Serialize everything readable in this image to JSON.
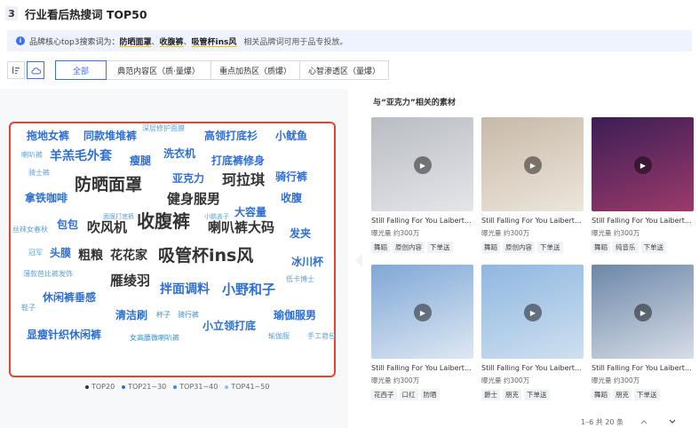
{
  "header": {
    "step": "3",
    "title": "行业看后热搜词 TOP50"
  },
  "notice": {
    "prefix": "品牌核心top3搜索词为：",
    "keywords": [
      "防晒面罩",
      "收腹裤",
      "吸管杯ins风"
    ],
    "sep": "、",
    "tail": "相关品牌词可用于品专投放。"
  },
  "toolbar": {
    "filters": [
      "全部",
      "典范内容区（质·量爆）",
      "重点加热区（质爆）",
      "心智渗透区（量爆）"
    ]
  },
  "cloud": {
    "words": [
      {
        "text": "拖地女裤",
        "tier": 2
      },
      {
        "text": "同款堆堆裤",
        "tier": 2
      },
      {
        "text": "深层修护面膜",
        "tier": 4
      },
      {
        "text": "高领打底衫",
        "tier": 2
      },
      {
        "text": "小鱿鱼",
        "tier": 2
      },
      {
        "text": "洗衣机",
        "tier": 2
      },
      {
        "text": "喇叭裤",
        "tier": 4
      },
      {
        "text": "羊羔毛外套",
        "tier": 2
      },
      {
        "text": "瘦腿",
        "tier": 2
      },
      {
        "text": "打底裤修身",
        "tier": 2
      },
      {
        "text": "骑士裤",
        "tier": 4
      },
      {
        "text": "防晒面罩",
        "tier": 1
      },
      {
        "text": "亚克力",
        "tier": 2
      },
      {
        "text": "珂拉琪",
        "tier": 1
      },
      {
        "text": "骑行裤",
        "tier": 2
      },
      {
        "text": "拿铁咖啡",
        "tier": 2
      },
      {
        "text": "健身服男",
        "tier": 1
      },
      {
        "text": "收腹",
        "tier": 2
      },
      {
        "text": "大容量",
        "tier": 2
      },
      {
        "text": "包包",
        "tier": 2
      },
      {
        "text": "面膜打底裤",
        "tier": 4
      },
      {
        "text": "收腹裤",
        "tier": 1
      },
      {
        "text": "小鹏盖子",
        "tier": 4
      },
      {
        "text": "丝袜女春秋",
        "tier": 4
      },
      {
        "text": "吹风机",
        "tier": 1
      },
      {
        "text": "喇叭裤大码",
        "tier": 1
      },
      {
        "text": "发夹",
        "tier": 2
      },
      {
        "text": "冠军",
        "tier": 4
      },
      {
        "text": "头膜",
        "tier": 2
      },
      {
        "text": "粗粮",
        "tier": 1
      },
      {
        "text": "花花家",
        "tier": 1
      },
      {
        "text": "吸管杯ins风",
        "tier": 1
      },
      {
        "text": "冰川杯",
        "tier": 2
      },
      {
        "text": "薄款芭比裤",
        "tier": 4
      },
      {
        "text": "发饰",
        "tier": 4
      },
      {
        "text": "雁绫羽",
        "tier": 1
      },
      {
        "text": "低卡博士",
        "tier": 4
      },
      {
        "text": "拌面调料",
        "tier": 2
      },
      {
        "text": "小野和子",
        "tier": 2
      },
      {
        "text": "休闲裤垂感",
        "tier": 2
      },
      {
        "text": "鞋子",
        "tier": 4
      },
      {
        "text": "清洁刷",
        "tier": 2
      },
      {
        "text": "杯子",
        "tier": 3
      },
      {
        "text": "骑行裤",
        "tier": 3
      },
      {
        "text": "瑜伽服男",
        "tier": 2
      },
      {
        "text": "小立领打底",
        "tier": 2
      },
      {
        "text": "显瘦针织休闲裤",
        "tier": 2
      },
      {
        "text": "女高腰微喇叭裤",
        "tier": 3
      },
      {
        "text": "瑜伽服",
        "tier": 4
      },
      {
        "text": "手工皂包",
        "tier": 4
      }
    ]
  },
  "legend": [
    {
      "label": "TOP20",
      "color": "#333333"
    },
    {
      "label": "TOP21~30",
      "color": "#2f6fd1"
    },
    {
      "label": "TOP31~40",
      "color": "#3a90c8"
    },
    {
      "label": "TOP41~50",
      "color": "#8fc1e6"
    }
  ],
  "materials": {
    "title": "与“亚克力”相关的素材",
    "cards": [
      {
        "title": "Still Falling For You Laibert...",
        "views": "曝光量 约300万",
        "tags": [
          "舞蹈",
          "原创内容",
          "下单送"
        ],
        "colors": [
          "#b9bcc2",
          "#e4e6ea"
        ]
      },
      {
        "title": "Still Falling For You Laibert...",
        "views": "曝光量 约300万",
        "tags": [
          "舞蹈",
          "原创内容",
          "下单送"
        ],
        "colors": [
          "#c7b9a8",
          "#ede6dc"
        ]
      },
      {
        "title": "Still Falling For You Laibert...",
        "views": "曝光量 约300万",
        "tags": [
          "舞蹈",
          "纯音乐",
          "下单送"
        ],
        "colors": [
          "#3b1e55",
          "#9c3a6a"
        ]
      },
      {
        "title": "Still Falling For You Laibert...",
        "views": "曝光量 约300万",
        "tags": [
          "花西子",
          "口红",
          "防晒"
        ],
        "colors": [
          "#7fa7d6",
          "#dfe8f2"
        ]
      },
      {
        "title": "Still Falling For You Laibert...",
        "views": "曝光量 约300万",
        "tags": [
          "爵士",
          "朋克",
          "下单送"
        ],
        "colors": [
          "#8fb7e0",
          "#cfe0ef"
        ]
      },
      {
        "title": "Still Falling For You Laibert...",
        "views": "曝光量 约300万",
        "tags": [
          "舞蹈",
          "朋克",
          "下单送"
        ],
        "colors": [
          "#6c87a8",
          "#d7dde6"
        ]
      }
    ]
  },
  "pager": {
    "text": "1–6 共 20 条"
  }
}
